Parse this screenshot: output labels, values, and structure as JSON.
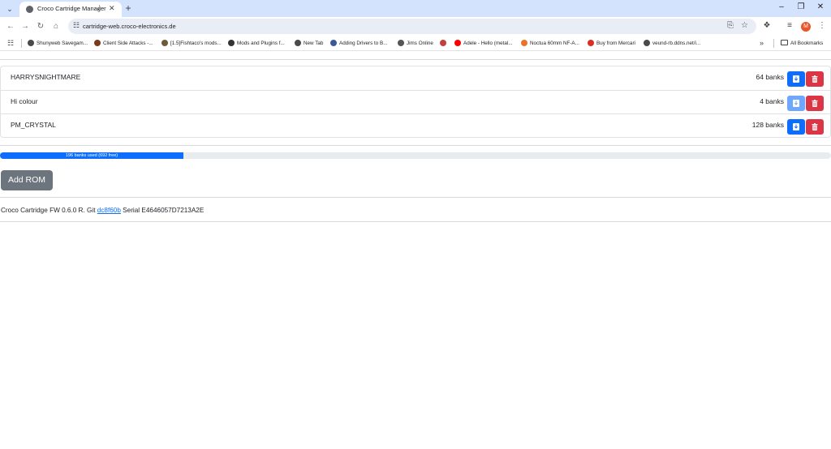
{
  "browser": {
    "tab": {
      "title": "Croco Cartridge Manager"
    },
    "url": "cartridge-web.croco-electronics.de",
    "profile_initial": "M",
    "bookmarks": [
      {
        "label": "Shunyweb Savegam...",
        "icon_color": "#4a4a4a"
      },
      {
        "label": "Client Side Attacks -...",
        "icon_color": "#7a3b1d"
      },
      {
        "label": "[1.5]Fishtaco's mods...",
        "icon_color": "#6b5b3a"
      },
      {
        "label": "Mods and Plugins f...",
        "icon_color": "#333333"
      },
      {
        "label": "New Tab",
        "icon_color": "#4a4a4a"
      },
      {
        "label": "Adding Drivers to B...",
        "icon_color": "#3b5998"
      },
      {
        "label": "Jims Online",
        "icon_color": "#555555"
      },
      {
        "label": "",
        "icon_color": "#c2413a"
      },
      {
        "label": "Adele - Hello (metal...",
        "icon_color": "#ff0000"
      },
      {
        "label": "Noctua 60mm NF-A...",
        "icon_color": "#e8742a"
      },
      {
        "label": "Buy from Mercari",
        "icon_color": "#d93025"
      },
      {
        "label": "veund-rb.ddns.net/i...",
        "icon_color": "#4a4a4a"
      }
    ],
    "all_bookmarks_label": "All Bookmarks"
  },
  "roms": [
    {
      "name": "HARRYSNIGHTMARE",
      "banks": "64 banks",
      "download_enabled": true
    },
    {
      "name": "Hi colour",
      "banks": "4 banks",
      "download_enabled": false
    },
    {
      "name": "PM_CRYSTAL",
      "banks": "128 banks",
      "download_enabled": true
    }
  ],
  "usage": {
    "label": "196 banks used (692 free)",
    "used_fraction": 0.2207
  },
  "add_rom_label": "Add ROM",
  "footer": {
    "prefix": "Croco Cartridge FW 0.6.0 R. Git ",
    "git_hash": "dc8f60b",
    "serial_text": " Serial E4646057D7213A2E"
  },
  "colors": {
    "primary": "#0d6efd",
    "danger": "#dc3545",
    "secondary": "#6c757d",
    "chrome_frame": "#d3e3fd"
  }
}
